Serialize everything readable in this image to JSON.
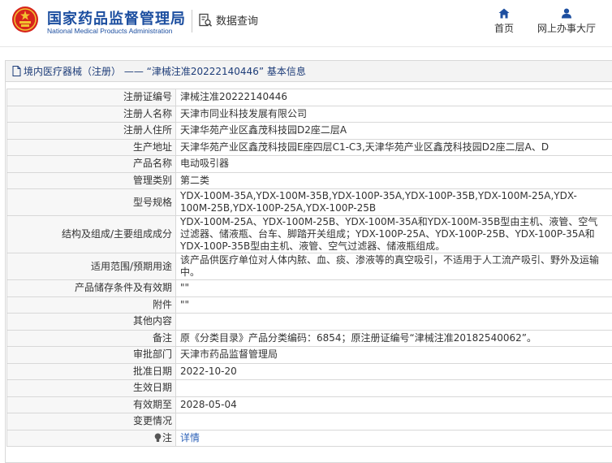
{
  "header": {
    "title_cn": "国家药品监督管理局",
    "title_en": "National Medical Products Administration",
    "query_label": "数据查询",
    "nav": [
      {
        "label": "首页",
        "icon": "home-icon"
      },
      {
        "label": "网上办事大厅",
        "icon": "user-icon"
      }
    ]
  },
  "panel": {
    "title": "境内医疗器械（注册） —— “津械注准20222140446” 基本信息"
  },
  "rows": [
    {
      "label": "注册证编号",
      "value": "津械注准20222140446"
    },
    {
      "label": "注册人名称",
      "value": "天津市同业科技发展有限公司"
    },
    {
      "label": "注册人住所",
      "value": "天津华苑产业区鑫茂科技园D2座二层A"
    },
    {
      "label": "生产地址",
      "value": "天津华苑产业区鑫茂科技园E座四层C1-C3,天津华苑产业区鑫茂科技园D2座二层A、D"
    },
    {
      "label": "产品名称",
      "value": "电动吸引器"
    },
    {
      "label": "管理类别",
      "value": "第二类"
    },
    {
      "label": "型号规格",
      "value": "YDX-100M-35A,YDX-100M-35B,YDX-100P-35A,YDX-100P-35B,YDX-100M-25A,YDX-100M-25B,YDX-100P-25A,YDX-100P-25B"
    },
    {
      "label": "结构及组成/主要组成成分",
      "value": "YDX-100M-25A、YDX-100M-25B、YDX-100M-35A和YDX-100M-35B型由主机、液管、空气过滤器、储液瓶、台车、脚踏开关组成；YDX-100P-25A、YDX-100P-25B、YDX-100P-35A和YDX-100P-35B型由主机、液管、空气过滤器、储液瓶组成。"
    },
    {
      "label": "适用范围/预期用途",
      "value": "该产品供医疗单位对人体内脓、血、痰、渗液等的真空吸引，不适用于人工流产吸引、野外及运输中。"
    },
    {
      "label": "产品储存条件及有效期",
      "value": "\"\""
    },
    {
      "label": "附件",
      "value": "\"\""
    },
    {
      "label": "其他内容",
      "value": ""
    },
    {
      "label": "备注",
      "value": "原《分类目录》产品分类编码：6854；原注册证编号“津械注准20182540062”。"
    },
    {
      "label": "审批部门",
      "value": "天津市药品监督管理局"
    },
    {
      "label": "批准日期",
      "value": "2022-10-20"
    },
    {
      "label": "生效日期",
      "value": ""
    },
    {
      "label": "有效期至",
      "value": "2028-05-04"
    },
    {
      "label": "变更情况",
      "value": ""
    }
  ],
  "note_row": {
    "label": "注",
    "link": "详情",
    "icon": "bulb-icon"
  },
  "colors": {
    "brand": "#1d4fa0",
    "link": "#2d62b8",
    "emblem_red": "#d7241c",
    "emblem_gold": "#f2c230"
  }
}
